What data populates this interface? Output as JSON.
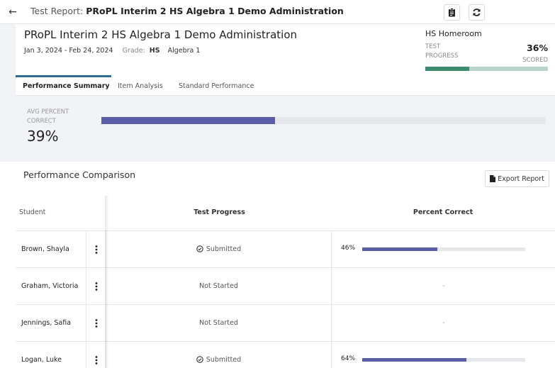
{
  "topbar": {
    "prefix": "Test Report:",
    "title": "PRoPL Interim 2 HS Algebra 1 Demo Administration",
    "back_icon": "arrow-left-icon",
    "clipboard_icon": "clipboard-icon",
    "refresh_icon": "refresh-icon"
  },
  "header": {
    "name": "PRoPL Interim 2 HS Algebra 1 Demo Administration",
    "dates": "Jan 3, 2024 - Feb 24, 2024",
    "grade_label": "Grade:",
    "grade": "HS",
    "course": "Algebra 1",
    "homeroom": "HS Homeroom",
    "progress_label": "TEST PROGRESS",
    "progress_pct": "36%",
    "progress_fraction": 0.36,
    "scored_label": "SCORED"
  },
  "tabs": [
    {
      "label": "Performance Summary",
      "active": true
    },
    {
      "label": "Item Analysis",
      "active": false
    },
    {
      "label": "Standard Performance",
      "active": false
    }
  ],
  "summary": {
    "label": "AVG PERCENT CORRECT",
    "value": "39%",
    "fraction": 0.39
  },
  "comparison": {
    "title": "Performance Comparison",
    "export_label": "Export Report",
    "columns": {
      "student": "Student",
      "progress": "Test Progress",
      "percent": "Percent Correct"
    },
    "rows": [
      {
        "student": "Brown, Shayla",
        "status": "Submitted",
        "submitted": true,
        "percent": "46%",
        "fraction": 0.46
      },
      {
        "student": "Graham, Victoria",
        "status": "Not Started",
        "submitted": false,
        "percent": "-",
        "fraction": null
      },
      {
        "student": "Jennings, Safia",
        "status": "Not Started",
        "submitted": false,
        "percent": "-",
        "fraction": null
      },
      {
        "student": "Logan, Luke",
        "status": "Submitted",
        "submitted": true,
        "percent": "64%",
        "fraction": 0.64
      }
    ]
  },
  "colors": {
    "accent": "#2f6c93",
    "progress_green": "#3c8c6e",
    "bar_purple": "#5b5ea6"
  }
}
